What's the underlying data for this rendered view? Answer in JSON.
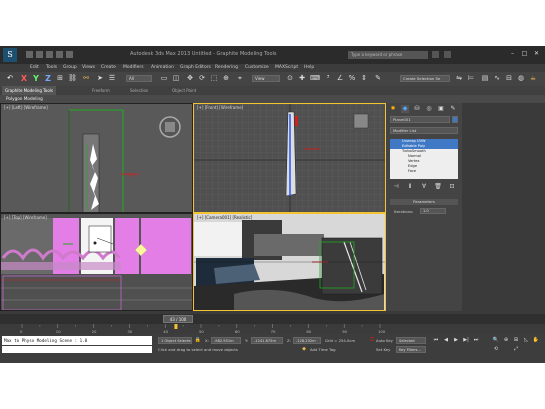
{
  "app": {
    "logo_text": "S",
    "title": "Autodesk 3ds Max 2013  Untitled - Graphite Modeling Tools",
    "search_placeholder": "Type a keyword or phrase",
    "window_controls": [
      "–",
      "□",
      "✕"
    ]
  },
  "menu": [
    "Edit",
    "Tools",
    "Group",
    "Views",
    "Create",
    "Modifiers",
    "Animation",
    "Graph Editors",
    "Rendering",
    "Customize",
    "MAXScript",
    "Help"
  ],
  "toolbar": {
    "axis_x": "X",
    "axis_y": "Y",
    "axis_z": "Z",
    "selection_filter": "All",
    "reference_coord": "View",
    "named_selection": "Create Selection Se"
  },
  "ribbon": {
    "tabs": [
      "Graphite Modeling Tools",
      "Freeform",
      "Selection",
      "Object Paint"
    ],
    "panel": "Polygon Modeling"
  },
  "viewports": {
    "top_left": "[+] [Left] [Wireframe]",
    "top_right": "[+] [Front] [Wireframe]",
    "bottom_left": "[+] [Top] [Wireframe]",
    "bottom_right": "[+] [Camera001] [Realistic]"
  },
  "command_panel": {
    "object_name": "Plane001",
    "modifier_list": "Modifier List",
    "stack": [
      {
        "label": "Unwrap UVW",
        "selected": true
      },
      {
        "label": "Editable Poly",
        "selected": true
      },
      {
        "label": "TurboSmooth",
        "selected": false
      },
      {
        "label": "Normal",
        "selected": false
      },
      {
        "label": "Vertex",
        "selected": false
      },
      {
        "label": "Edge",
        "selected": false
      },
      {
        "label": "Face",
        "selected": false
      }
    ],
    "rollout_title": "Parameters",
    "param_label": "Iterations:",
    "param_value": "1.0"
  },
  "timeline": {
    "frame_display": "43 / 100",
    "ticks": [
      "0",
      "10",
      "20",
      "30",
      "40",
      "50",
      "60",
      "70",
      "80",
      "90",
      "100"
    ],
    "frame_position": 0.43
  },
  "status": {
    "listener_text": "Max to Physx Modeling Scene : 1.0",
    "selection_info": "1 Object Selected",
    "prompt": "Click and drag to select and move objects",
    "x_label": "X:",
    "x_value": "-982.951m",
    "y_label": "Y:",
    "y_value": "-1241.875m",
    "z_label": "Z:",
    "z_value": "-128.252m",
    "grid": "Grid = 254.0cm",
    "auto_key": "Auto Key",
    "set_key": "Set Key",
    "key_mode": "Selected",
    "key_filters": "Key Filters...",
    "add_time_tag": "Add Time Tag"
  },
  "colors": {
    "selected_row": "#3f79c6",
    "active_border": "#f4c430",
    "accent_red": "#cc2222",
    "wire_green": "#22aa22"
  }
}
